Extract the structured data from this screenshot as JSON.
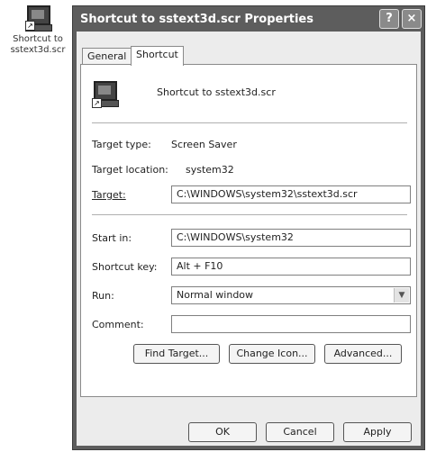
{
  "desktop_icon": {
    "label_line1": "Shortcut to",
    "label_line2": "sstext3d.scr"
  },
  "window": {
    "title": "Shortcut to sstext3d.scr Properties",
    "help_glyph": "?",
    "close_glyph": "×"
  },
  "tabs": [
    {
      "label": "General",
      "active": false
    },
    {
      "label": "Shortcut",
      "active": true
    }
  ],
  "panel": {
    "file_name": "Shortcut to sstext3d.scr",
    "target_type": {
      "label": "Target type:",
      "value": "Screen Saver"
    },
    "target_location": {
      "label": "Target location:",
      "value": "system32"
    },
    "target": {
      "label": "Target:",
      "value": "C:\\WINDOWS\\system32\\sstext3d.scr"
    },
    "start_in": {
      "label": "Start in:",
      "value": "C:\\WINDOWS\\system32"
    },
    "shortcut_key": {
      "label": "Shortcut key:",
      "value": "Alt + F10"
    },
    "run": {
      "label": "Run:",
      "value": "Normal window"
    },
    "comment": {
      "label": "Comment:",
      "value": ""
    },
    "buttons": {
      "find_target": "Find Target...",
      "change_icon": "Change Icon...",
      "advanced": "Advanced..."
    }
  },
  "footer": {
    "ok": "OK",
    "cancel": "Cancel",
    "apply": "Apply"
  }
}
